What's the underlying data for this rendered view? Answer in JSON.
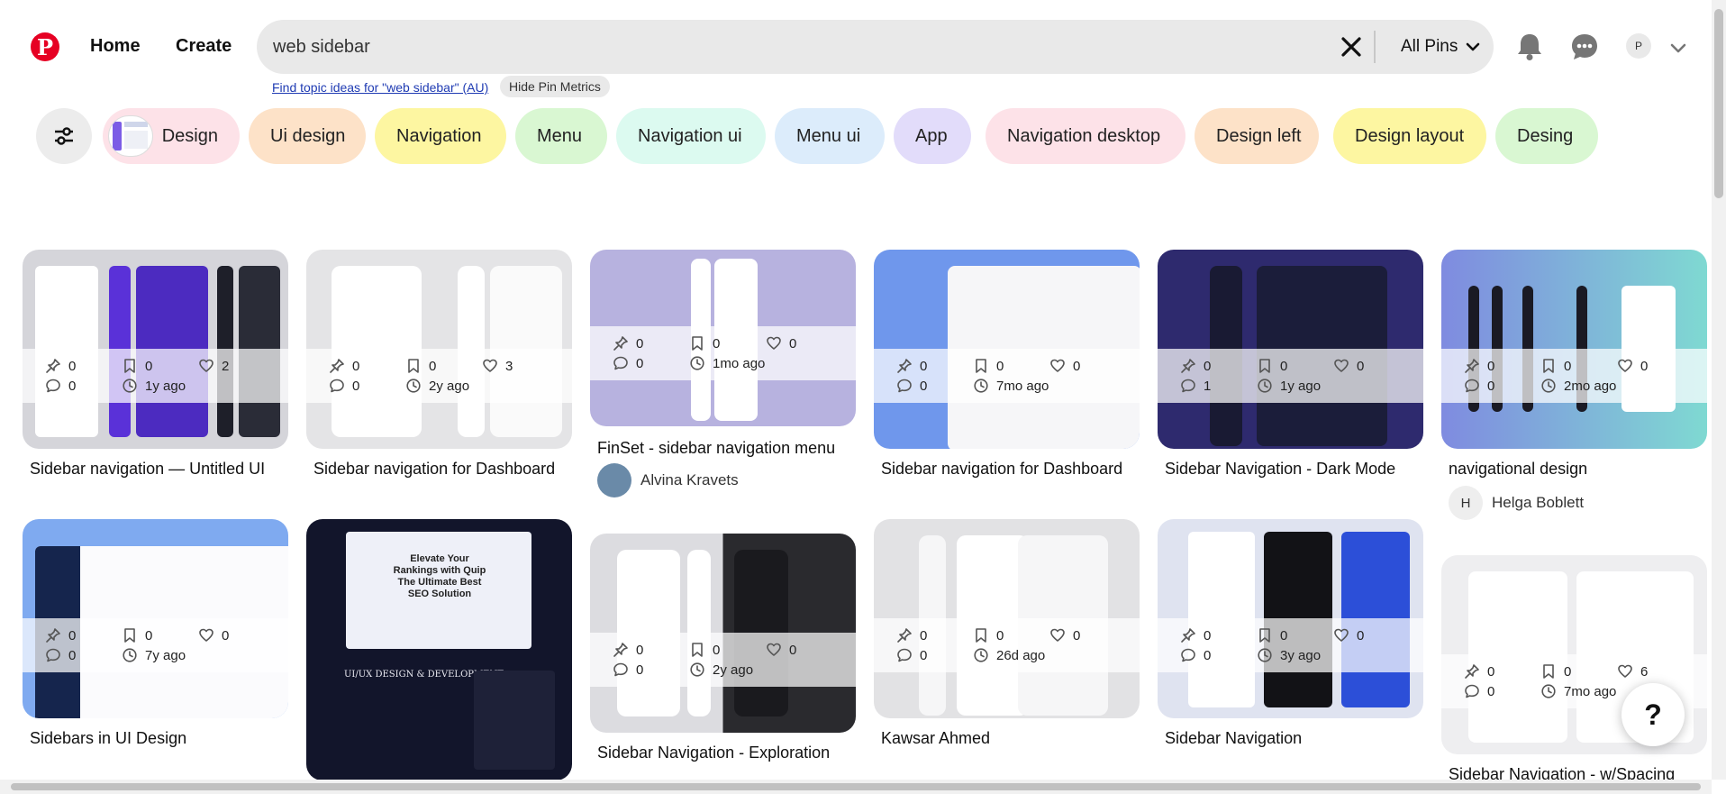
{
  "header": {
    "home_label": "Home",
    "create_label": "Create",
    "search_value": "web sidebar",
    "scope_label": "All Pins",
    "avatar_initial": "P",
    "topic_link": "Find topic ideas for \"web sidebar\" (AU)",
    "hide_metrics_label": "Hide Pin Metrics"
  },
  "chips": [
    {
      "label": "Design",
      "color": "#fde2e8"
    },
    {
      "label": "Ui design",
      "color": "#fde2c8"
    },
    {
      "label": "Navigation",
      "color": "#fdf6a1"
    },
    {
      "label": "Menu",
      "color": "#d9f7d2"
    },
    {
      "label": "Navigation ui",
      "color": "#dcfaf0"
    },
    {
      "label": "Menu ui",
      "color": "#dcecfb"
    },
    {
      "label": "App",
      "color": "#e2dcfa"
    },
    {
      "label": "Navigation desktop",
      "color": "#fde2e8"
    },
    {
      "label": "Design left",
      "color": "#fde2c8"
    },
    {
      "label": "Design layout",
      "color": "#fdf6a1"
    },
    {
      "label": "Desing",
      "color": "#d9f7d2"
    }
  ],
  "pins": [
    {
      "title": "Sidebar navigation — Untitled UI",
      "saves": "0",
      "bookmarks": "0",
      "likes": "2",
      "comments": "0",
      "age": "1y ago",
      "author": "",
      "author_initial": "",
      "bg": "#d5d5da"
    },
    {
      "title": "Sidebar navigation for Dashboard",
      "saves": "0",
      "bookmarks": "0",
      "likes": "3",
      "comments": "0",
      "age": "2y ago",
      "author": "",
      "author_initial": "",
      "bg": "#e4e4e6"
    },
    {
      "title": "FinSet - sidebar navigation menu",
      "saves": "0",
      "bookmarks": "0",
      "likes": "0",
      "comments": "0",
      "age": "1mo ago",
      "author": "Alvina Kravets",
      "author_initial": "",
      "bg": "#b7b2df"
    },
    {
      "title": "Sidebar navigation for Dashboard",
      "saves": "0",
      "bookmarks": "0",
      "likes": "0",
      "comments": "0",
      "age": "7mo ago",
      "author": "",
      "author_initial": "",
      "bg": "#6f97ec"
    },
    {
      "title": "Sidebar Navigation - Dark Mode",
      "saves": "0",
      "bookmarks": "0",
      "likes": "0",
      "comments": "1",
      "age": "1y ago",
      "author": "",
      "author_initial": "",
      "bg": "#2e2a6e"
    },
    {
      "title": "navigational design",
      "saves": "0",
      "bookmarks": "0",
      "likes": "0",
      "comments": "0",
      "age": "2mo ago",
      "author": "Helga Boblett",
      "author_initial": "H",
      "bg": "#8fa6e6"
    },
    {
      "title": "Sidebars in UI Design",
      "saves": "0",
      "bookmarks": "0",
      "likes": "0",
      "comments": "0",
      "age": "7y ago",
      "author": "",
      "author_initial": "",
      "bg": "#7faaf0"
    },
    {
      "title": "",
      "saves": "",
      "bookmarks": "",
      "likes": "",
      "comments": "",
      "age": "",
      "author": "",
      "author_initial": "",
      "bg": "#12152b"
    },
    {
      "title": "Sidebar Navigation - Exploration",
      "saves": "0",
      "bookmarks": "0",
      "likes": "0",
      "comments": "0",
      "age": "2y ago",
      "author": "",
      "author_initial": "",
      "bg": "#dcdce0"
    },
    {
      "title": "Kawsar Ahmed",
      "saves": "0",
      "bookmarks": "0",
      "likes": "0",
      "comments": "0",
      "age": "26d ago",
      "author": "",
      "author_initial": "",
      "bg": "#e2e2e4"
    },
    {
      "title": "Sidebar Navigation",
      "saves": "0",
      "bookmarks": "0",
      "likes": "0",
      "comments": "0",
      "age": "3y ago",
      "author": "",
      "author_initial": "",
      "bg": "#dfe3f0"
    },
    {
      "title": "Sidebar Navigation - w/Spacing",
      "saves": "0",
      "bookmarks": "0",
      "likes": "6",
      "comments": "0",
      "age": "7mo ago",
      "author": "",
      "author_initial": "",
      "bg": "#eeeef0"
    }
  ],
  "seo_pin": {
    "headline": "Elevate Your Rankings with Quip The Ultimate Best SEO Solution",
    "section": "UI/UX DESIGN & DEVELOPMENT"
  },
  "help_label": "?"
}
